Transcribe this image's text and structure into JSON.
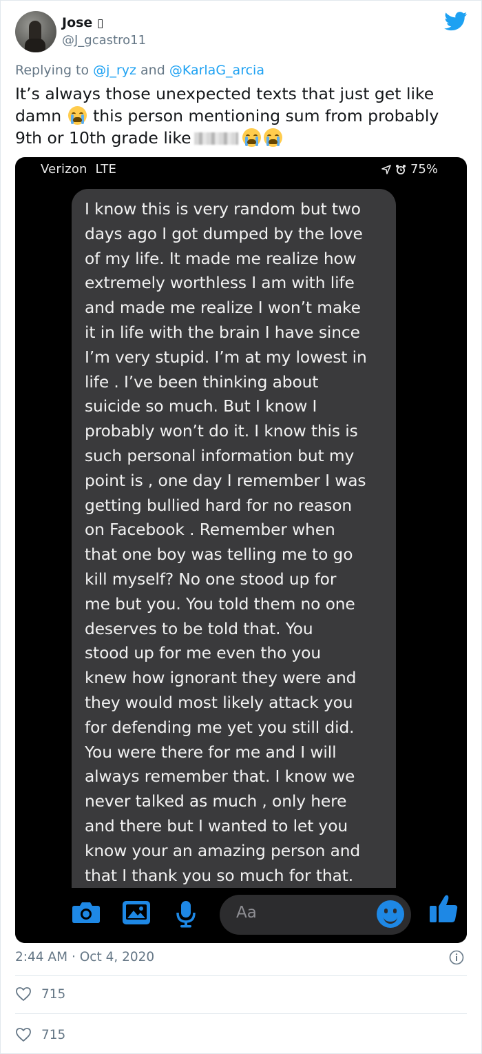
{
  "author": {
    "name": "Jose",
    "name_glyph": "▯",
    "handle": "@J_gcastro11"
  },
  "reply": {
    "prefix": "Replying to",
    "user1": "@j_ryz",
    "conjunction": "and",
    "user2": "@KarlaG_arcia"
  },
  "tweet": {
    "line1": "It’s always those unexpected texts that just get like",
    "line2_a": "damn",
    "line2_b": "this person mentioning sum from probably",
    "line3": "9th or 10th grade like"
  },
  "phone": {
    "carrier": "Verizon",
    "network": "LTE",
    "battery": "75%",
    "message_lines": [
      "I know this is very random but two",
      "days ago I got dumped by the love",
      "of my life. It made me realize how",
      "extremely worthless I am with life",
      "and made me realize I won’t make",
      "it in life with the brain I have since",
      "I’m very stupid. I’m at my lowest in",
      "life . I’ve been thinking about",
      "suicide so much. But I know I",
      "probably won’t do it. I know this is",
      "such personal information but my",
      "point is , one day I remember I was",
      "getting bullied hard for no reason",
      "on Facebook . Remember when",
      "that one boy was telling me to go",
      "kill myself? No one stood up for",
      "me but you. You told them no one",
      "deserves to be told that. You",
      "stood up for me even tho you",
      "knew how ignorant they were and",
      "they would most likely attack you",
      "for defending me yet you still did.",
      "You were there for me and I will",
      "always remember that. I know we",
      "never talked as much , only here",
      "and there but I wanted to let you",
      "know your an amazing person and",
      "that I thank you so much for that."
    ],
    "composer_placeholder": "Aa",
    "accent_color": "#1e88e5"
  },
  "meta": {
    "time": "2:44 AM",
    "separator": "·",
    "date": "Oct 4, 2020"
  },
  "likes": [
    {
      "count": "715"
    },
    {
      "count": "715"
    }
  ],
  "colors": {
    "twitter_blue": "#1da1f2",
    "muted": "#657786"
  }
}
